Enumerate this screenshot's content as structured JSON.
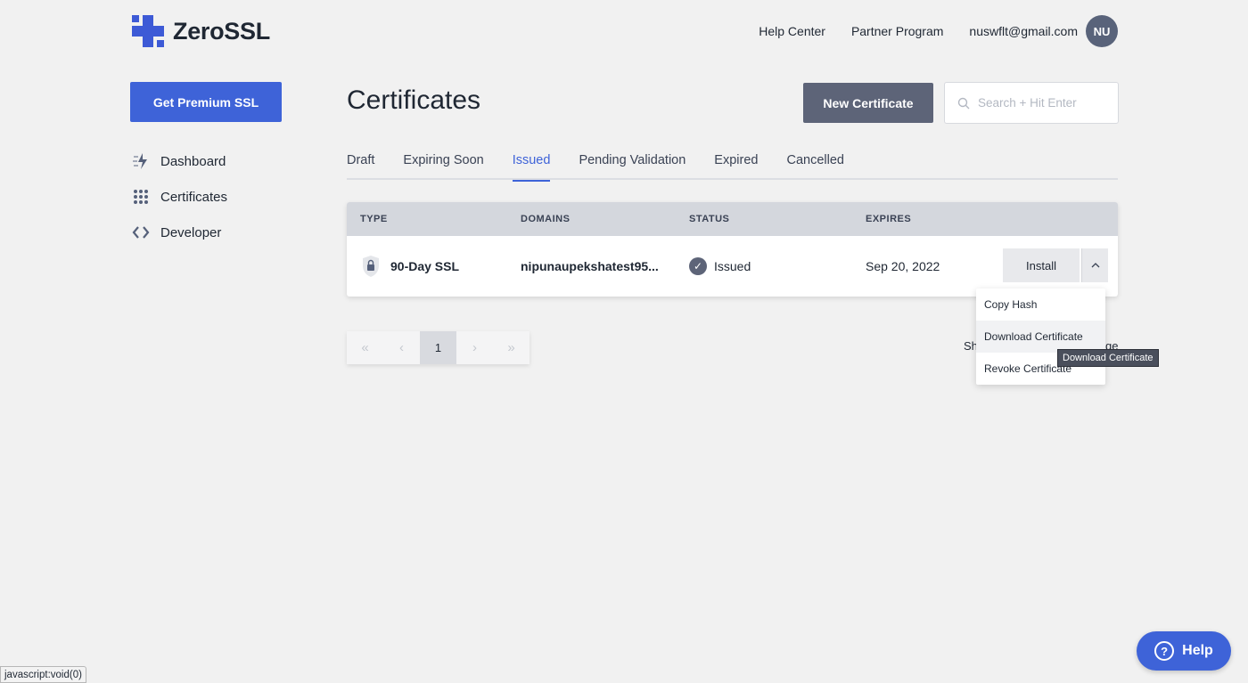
{
  "brand": {
    "name": "ZeroSSL",
    "color": "#3d5ad6"
  },
  "header": {
    "links": [
      "Help Center",
      "Partner Program"
    ],
    "email": "nuswflt@gmail.com",
    "avatar_initials": "NU"
  },
  "sidebar": {
    "cta": "Get Premium SSL",
    "items": [
      {
        "label": "Dashboard",
        "icon": "lightning-icon"
      },
      {
        "label": "Certificates",
        "icon": "grid-icon"
      },
      {
        "label": "Developer",
        "icon": "code-icon"
      }
    ]
  },
  "main": {
    "title": "Certificates",
    "new_button": "New Certificate",
    "search_placeholder": "Search + Hit Enter",
    "tabs": [
      "Draft",
      "Expiring Soon",
      "Issued",
      "Pending Validation",
      "Expired",
      "Cancelled"
    ],
    "active_tab": "Issued"
  },
  "table": {
    "columns": [
      "TYPE",
      "DOMAINS",
      "STATUS",
      "EXPIRES"
    ],
    "rows": [
      {
        "type": "90-Day SSL",
        "domain": "nipunaupekshatest95...",
        "status": "Issued",
        "expires": "Sep 20, 2022",
        "action": "Install"
      }
    ]
  },
  "dropdown": {
    "items": [
      "Copy Hash",
      "Download Certificate",
      "Revoke Certificate"
    ],
    "tooltip": "Download Certificate"
  },
  "pagination": {
    "first": "«",
    "prev": "‹",
    "current": "1",
    "next": "›",
    "last": "»",
    "show_start": "Sh",
    "show_end": "ge"
  },
  "help_button": "Help",
  "status_bar": "javascript:void(0)",
  "colors": {
    "accent": "#3e63d8",
    "dark_button": "#5d6478",
    "background": "#f1f1f1"
  }
}
